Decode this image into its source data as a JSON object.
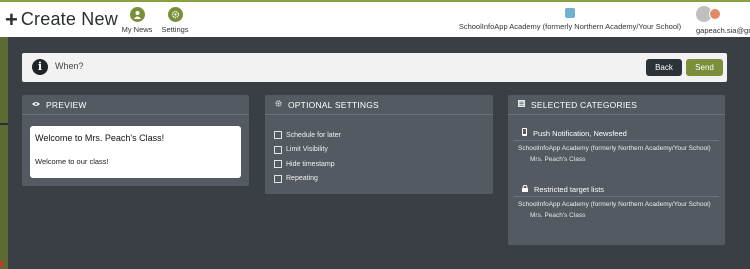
{
  "header": {
    "plus": "+",
    "title": "Create New",
    "nav": [
      {
        "label": "My News",
        "icon": "user-icon"
      },
      {
        "label": "Settings",
        "icon": "gear-icon"
      }
    ],
    "school_label": "SchoolInfoApp Academy (formerly Northern Academy/Your School)",
    "user_email": "gapeach.sia@gmail.com"
  },
  "when_bar": {
    "icon": "info-icon",
    "label": "When?",
    "back_label": "Back",
    "send_label": "Send"
  },
  "preview": {
    "heading": "PREVIEW",
    "icon": "eye-icon",
    "card_title": "Welcome to Mrs. Peach's Class!",
    "card_body": "Welcome to our class!"
  },
  "optional": {
    "heading": "OPTIONAL SETTINGS",
    "icon": "gear-icon",
    "items": [
      {
        "label": "Schedule for later",
        "checked": false
      },
      {
        "label": "Limit Visibility",
        "checked": false
      },
      {
        "label": "Hide timestamp",
        "checked": false
      },
      {
        "label": "Repeating",
        "checked": false
      }
    ]
  },
  "selected": {
    "heading": "SELECTED CATEGORIES",
    "icon": "list-icon",
    "groups": [
      {
        "title": "Push Notification, Newsfeed",
        "icon": "mobile-icon",
        "school": "SchoolInfoApp Academy (formerly Northern Academy/Your School)",
        "class": "Mrs. Peach's Class"
      },
      {
        "title": "Restricted target lists",
        "icon": "lock-icon",
        "school": "SchoolInfoApp Academy (formerly Northern Academy/Your School)",
        "class": "Mrs. Peach's Class"
      }
    ]
  },
  "colors": {
    "accent": "#7b8f3b",
    "background": "#3a3f45",
    "panel": "#535a61"
  }
}
